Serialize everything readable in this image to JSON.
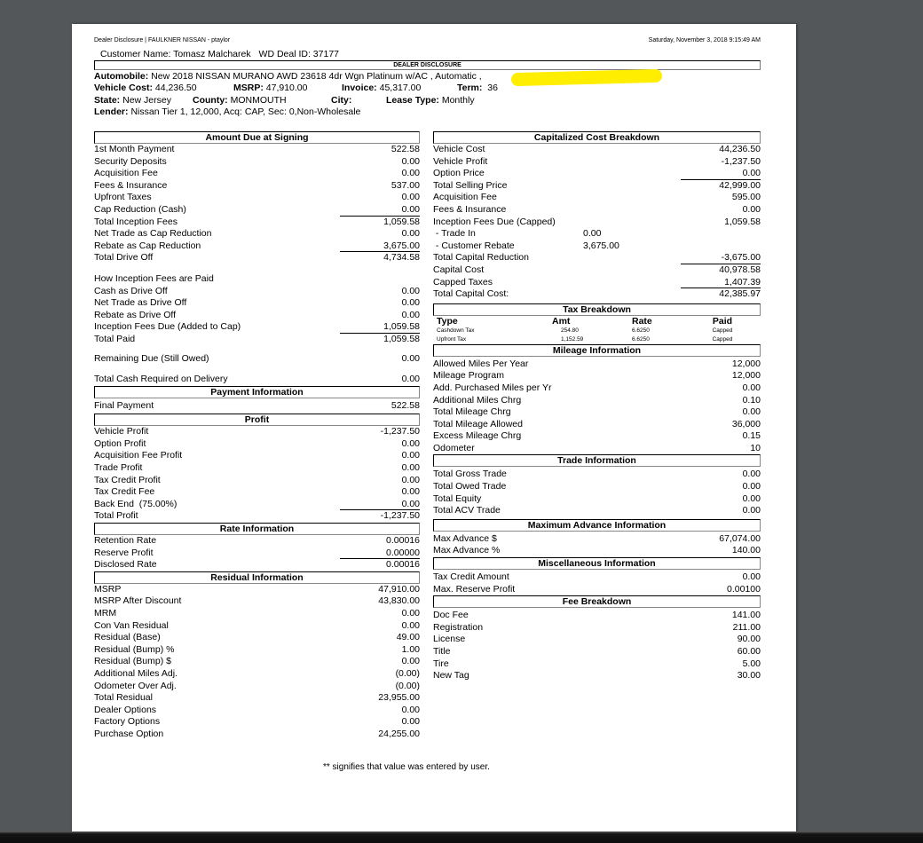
{
  "header": {
    "source": "Dealer Disclosure | FAULKNER NISSAN - ptaylor",
    "timestamp": "Saturday, November 3, 2018 9:15:49 AM",
    "customer_label": "Customer Name: Tomasz Malcharek",
    "deal_label": "WD Deal ID: 37177",
    "box_title": "DEALER DISCLOSURE",
    "automobile_label": "Automobile:",
    "automobile_value": "New 2018  NISSAN MURANO AWD 23618 4dr Wgn Platinum  w/AC ,  Automatic ,",
    "vehicle_cost_label": "Vehicle Cost:",
    "vehicle_cost_value": "44,236.50",
    "msrp_label": "MSRP:",
    "msrp_value": "47,910.00",
    "invoice_label": "Invoice:",
    "invoice_value": "45,317.00",
    "term_label": "Term:",
    "term_value": "36",
    "state_label": "State:",
    "state_value": "New Jersey",
    "county_label": "County:",
    "county_value": "MONMOUTH",
    "city_label": "City:",
    "city_value": "",
    "lease_type_label": "Lease Type:",
    "lease_type_value": "Monthly",
    "lender_label": "Lender:",
    "lender_value": "Nissan Tier 1, 12,000, Acq: CAP, Sec: 0,Non-Wholesale",
    "redaction_color": "#ffee00"
  },
  "amount_due": {
    "title": "Amount Due at Signing",
    "rows": [
      {
        "label": "1st Month Payment",
        "value": "522.58"
      },
      {
        "label": "Security Deposits",
        "value": "0.00"
      },
      {
        "label": "Acquisition Fee",
        "value": "0.00"
      },
      {
        "label": "Fees & Insurance",
        "value": "537.00"
      },
      {
        "label": "Upfront Taxes",
        "value": "0.00"
      },
      {
        "label": "Cap Reduction (Cash)",
        "value": "0.00"
      },
      {
        "label": "Total Inception Fees",
        "value": "1,059.58"
      },
      {
        "label": "Net Trade as Cap Reduction",
        "value": "0.00"
      },
      {
        "label": "Rebate as Cap Reduction",
        "value": "3,675.00"
      },
      {
        "label": "Total Drive Off",
        "value": "4,734.58"
      }
    ],
    "how_paid_label": "How Inception Fees are Paid",
    "paid_rows": [
      {
        "label": "Cash as Drive Off",
        "value": "0.00"
      },
      {
        "label": "Net Trade as Drive Off",
        "value": "0.00"
      },
      {
        "label": "Rebate as Drive Off",
        "value": "0.00"
      },
      {
        "label": "Inception Fees Due (Added to Cap)",
        "value": "1,059.58"
      },
      {
        "label": "Total Paid",
        "value": "1,059.58"
      }
    ],
    "remaining": {
      "label": "Remaining Due (Still Owed)",
      "value": "0.00"
    },
    "cash_required": {
      "label": "Total Cash Required on Delivery",
      "value": "0.00"
    }
  },
  "payment_info": {
    "title": "Payment Information",
    "rows": [
      {
        "label": "Final Payment",
        "value": "522.58"
      }
    ]
  },
  "profit": {
    "title": "Profit",
    "rows": [
      {
        "label": "Vehicle Profit",
        "value": "-1,237.50"
      },
      {
        "label": "Option Profit",
        "value": "0.00"
      },
      {
        "label": "Acquisition Fee Profit",
        "value": "0.00"
      },
      {
        "label": "Trade Profit",
        "value": "0.00"
      },
      {
        "label": "Tax Credit Profit",
        "value": "0.00"
      },
      {
        "label": "Tax Credit Fee",
        "value": "0.00"
      },
      {
        "label": "Back End  (75.00%)",
        "value": "0.00"
      },
      {
        "label": "Total Profit",
        "value": "-1,237.50"
      }
    ]
  },
  "rate_info": {
    "title": "Rate Information",
    "rows": [
      {
        "label": "Retention Rate",
        "value": "0.00016"
      },
      {
        "label": "Reserve Profit",
        "value": "0.00000"
      },
      {
        "label": "Disclosed Rate",
        "value": "0.00016"
      }
    ]
  },
  "residual_info": {
    "title": "Residual Information",
    "rows": [
      {
        "label": "MSRP",
        "value": "47,910.00"
      },
      {
        "label": "MSRP After Discount",
        "value": "43,830.00"
      },
      {
        "label": "MRM",
        "value": "0.00"
      },
      {
        "label": "Con Van Residual",
        "value": "0.00"
      },
      {
        "label": "Residual (Base)",
        "value": "49.00"
      },
      {
        "label": "Residual (Bump) %",
        "value": "1.00"
      },
      {
        "label": "Residual (Bump) $",
        "value": "0.00"
      },
      {
        "label": "Additional Miles Adj.",
        "value": "(0.00)"
      },
      {
        "label": "Odometer Over Adj.",
        "value": "(0.00)"
      },
      {
        "label": "Total Residual",
        "value": "23,955.00"
      },
      {
        "label": "Dealer Options",
        "value": "0.00"
      },
      {
        "label": "Factory Options",
        "value": "0.00"
      },
      {
        "label": "Purchase Option",
        "value": "24,255.00"
      }
    ]
  },
  "cap_cost": {
    "title": "Capitalized Cost Breakdown",
    "rows": [
      {
        "label": "Vehicle Cost",
        "mid": "",
        "value": "44,236.50"
      },
      {
        "label": "Vehicle Profit",
        "mid": "",
        "value": "-1,237.50"
      },
      {
        "label": "Option Price",
        "mid": "",
        "value": "0.00"
      },
      {
        "label": "Total Selling Price",
        "mid": "",
        "value": "42,999.00"
      },
      {
        "label": "Acquisition Fee",
        "mid": "",
        "value": "595.00"
      },
      {
        "label": "Fees & Insurance",
        "mid": "",
        "value": "0.00"
      },
      {
        "label": "Inception Fees Due (Capped)",
        "mid": "",
        "value": "1,059.58"
      },
      {
        "label": " - Trade In",
        "mid": "0.00",
        "value": ""
      },
      {
        "label": " - Customer Rebate",
        "mid": "3,675.00",
        "value": ""
      },
      {
        "label": "Total Capital Reduction",
        "mid": "",
        "value": "-3,675.00"
      },
      {
        "label": "Capital Cost",
        "mid": "",
        "value": "40,978.58"
      },
      {
        "label": "Capped Taxes",
        "mid": "",
        "value": "1,407.39"
      },
      {
        "label": "Total Capital Cost:",
        "mid": "",
        "value": "42,385.97"
      }
    ]
  },
  "tax_breakdown": {
    "title": "Tax Breakdown",
    "columns": [
      "Type",
      "Amt",
      "Rate",
      "Paid"
    ],
    "rows": [
      [
        "Cashdown Tax",
        "254.80",
        "6.6250",
        "Capped"
      ],
      [
        "Upfront Tax",
        "1,152.59",
        "6.6250",
        "Capped"
      ]
    ]
  },
  "mileage_info": {
    "title": "Mileage Information",
    "rows": [
      {
        "label": "Allowed Miles Per Year",
        "value": "12,000"
      },
      {
        "label": "Mileage Program",
        "value": "12,000"
      },
      {
        "label": "Add. Purchased Miles per Yr",
        "value": "0.00"
      },
      {
        "label": "Additional Miles Chrg",
        "value": "0.10"
      },
      {
        "label": "Total Mileage Chrg",
        "value": "0.00"
      },
      {
        "label": "Total Mileage Allowed",
        "value": "36,000"
      },
      {
        "label": "Excess Mileage Chrg",
        "value": "0.15"
      },
      {
        "label": "Odometer",
        "value": "10"
      }
    ]
  },
  "trade_info": {
    "title": "Trade Information",
    "rows": [
      {
        "label": "Total Gross Trade",
        "value": "0.00"
      },
      {
        "label": "Total Owed Trade",
        "value": "0.00"
      },
      {
        "label": "Total Equity",
        "value": "0.00"
      },
      {
        "label": "Total ACV Trade",
        "value": "0.00"
      }
    ]
  },
  "max_advance": {
    "title": "Maximum Advance Information",
    "rows": [
      {
        "label": "Max Advance $",
        "value": "67,074.00"
      },
      {
        "label": "Max Advance %",
        "value": "140.00"
      }
    ]
  },
  "misc_info": {
    "title": "Miscellaneous Information",
    "rows": [
      {
        "label": "Tax Credit Amount",
        "value": "0.00"
      },
      {
        "label": "Max. Reserve Profit",
        "value": "0.00100"
      }
    ]
  },
  "fee_breakdown": {
    "title": "Fee Breakdown",
    "rows": [
      {
        "label": "Doc Fee",
        "value": "141.00"
      },
      {
        "label": "Registration",
        "value": "211.00"
      },
      {
        "label": "License",
        "value": "90.00"
      },
      {
        "label": "Title",
        "value": "60.00"
      },
      {
        "label": "Tire",
        "value": "5.00"
      },
      {
        "label": "New Tag",
        "value": "30.00"
      }
    ]
  },
  "footnote": "** signifies that value was entered by user."
}
